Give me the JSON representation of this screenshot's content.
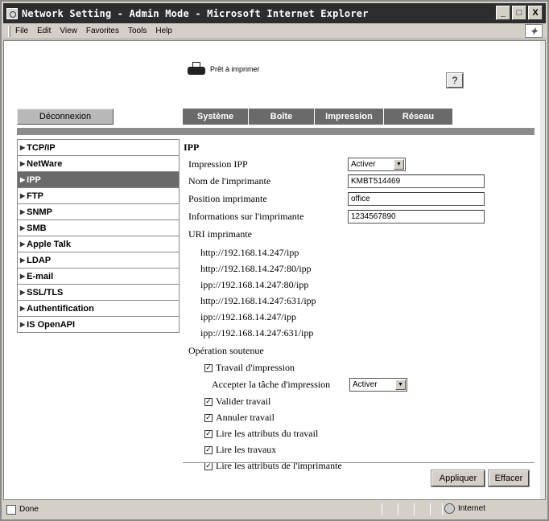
{
  "window": {
    "title": "Network Setting - Admin Mode - Microsoft Internet Explorer",
    "buttons": {
      "minimize": "_",
      "maximize": "□",
      "close": "X"
    }
  },
  "menubar": [
    "File",
    "Edit",
    "View",
    "Favorites",
    "Tools",
    "Help"
  ],
  "header": {
    "printer_status": "Prêt à imprimer",
    "help": "?",
    "logout": "Déconnexion"
  },
  "tabs": [
    "Système",
    "Boîte",
    "Impression",
    "Réseau"
  ],
  "sidebar": {
    "items": [
      {
        "label": "TCP/IP",
        "active": false
      },
      {
        "label": "NetWare",
        "active": false
      },
      {
        "label": "IPP",
        "active": true
      },
      {
        "label": "FTP",
        "active": false
      },
      {
        "label": "SNMP",
        "active": false
      },
      {
        "label": "SMB",
        "active": false
      },
      {
        "label": "Apple Talk",
        "active": false
      },
      {
        "label": "LDAP",
        "active": false
      },
      {
        "label": "E-mail",
        "active": false
      },
      {
        "label": "SSL/TLS",
        "active": false
      },
      {
        "label": "Authentification",
        "active": false
      },
      {
        "label": "IS OpenAPI",
        "active": false
      }
    ]
  },
  "ipp": {
    "section_title": "IPP",
    "impression_ipp": {
      "label": "Impression IPP",
      "value": "Activer"
    },
    "printer_name": {
      "label": "Nom de l'imprimante",
      "value": "KMBT514469"
    },
    "printer_location": {
      "label": "Position imprimante",
      "value": "office"
    },
    "printer_info": {
      "label": "Informations sur l'imprimante",
      "value": "1234567890"
    },
    "uri_label": "URI imprimante",
    "uris": [
      "http://192.168.14.247/ipp",
      "http://192.168.14.247:80/ipp",
      "ipp://192.168.14.247:80/ipp",
      "http://192.168.14.247:631/ipp",
      "ipp://192.168.14.247/ipp",
      "ipp://192.168.14.247:631/ipp"
    ],
    "operations_label": "Opération soutenue",
    "print_job": {
      "label": "Travail d'impression",
      "checked": true
    },
    "accept_job": {
      "label": "Accepter la tâche d'impression",
      "value": "Activer"
    },
    "operations": [
      {
        "label": "Valider travail",
        "checked": true
      },
      {
        "label": "Annuler travail",
        "checked": true
      },
      {
        "label": "Lire les attributs du travail",
        "checked": true
      },
      {
        "label": "Lire les travaux",
        "checked": true
      },
      {
        "label": "Lire les attributs de l'imprimante",
        "checked": true
      }
    ]
  },
  "actions": {
    "apply": "Appliquer",
    "clear": "Effacer"
  },
  "statusbar": {
    "status": "Done",
    "zone": "Internet"
  }
}
